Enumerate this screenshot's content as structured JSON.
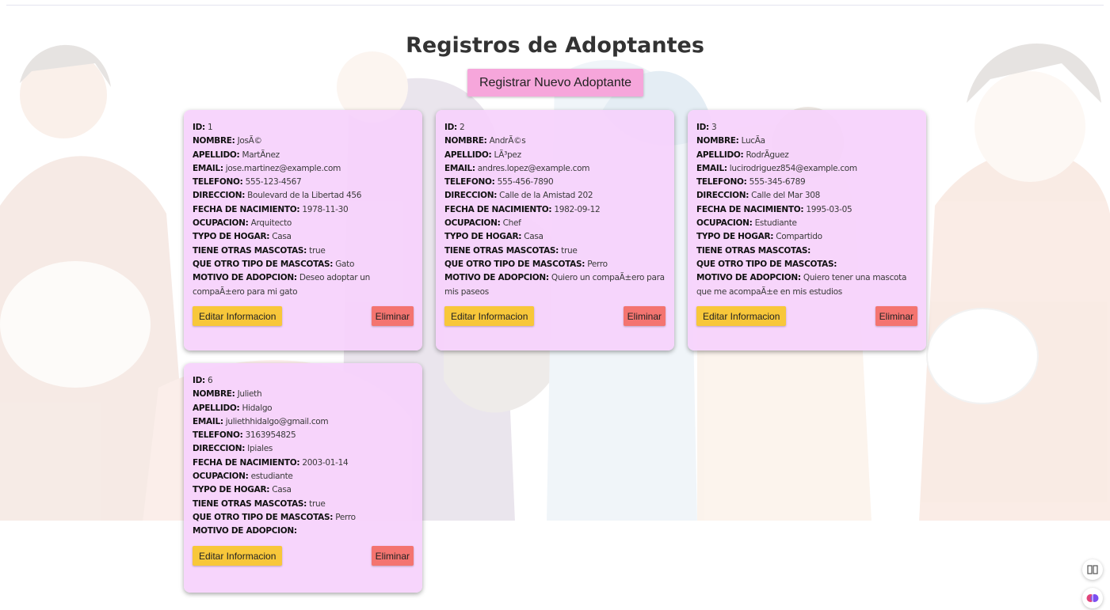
{
  "page": {
    "title": "Registros de Adoptantes",
    "register_button": "Registrar Nuevo Adoptante"
  },
  "labels": {
    "id": "ID:",
    "nombre": "NOMBRE:",
    "apellido": "APELLIDO:",
    "email": "EMAIL:",
    "telefono": "TELEFONO:",
    "direccion": "DIRECCION:",
    "fecha": "FECHA DE NACIMIENTO:",
    "ocupacion": "OCUPACION:",
    "hogar": "TYPO DE HOGAR:",
    "otras": "TIENE OTRAS MASCOTAS:",
    "tipo": "QUE OTRO TIPO DE MASCOTAS:",
    "motivo": "MOTIVO DE ADOPCION:"
  },
  "buttons": {
    "edit": "Editar Informacion",
    "delete": "Eliminar"
  },
  "cards": [
    {
      "id": "1",
      "nombre": "JosÃ©",
      "apellido": "MartÃnez",
      "email": "jose.martinez@example.com",
      "telefono": "555-123-4567",
      "direccion": "Boulevard de la Libertad 456",
      "fecha": "1978-11-30",
      "ocupacion": "Arquitecto",
      "hogar": "Casa",
      "otras": "true",
      "tipo": "Gato",
      "motivo": "Deseo adoptar un compaÃ±ero para mi gato"
    },
    {
      "id": "2",
      "nombre": "AndrÃ©s",
      "apellido": "LÃ³pez",
      "email": "andres.lopez@example.com",
      "telefono": "555-456-7890",
      "direccion": "Calle de la Amistad 202",
      "fecha": "1982-09-12",
      "ocupacion": "Chef",
      "hogar": "Casa",
      "otras": "true",
      "tipo": "Perro",
      "motivo": "Quiero un compaÃ±ero para mis paseos"
    },
    {
      "id": "3",
      "nombre": "LucÃa",
      "apellido": "RodrÃguez",
      "email": "lucirodriguez854@example.com",
      "telefono": "555-345-6789",
      "direccion": "Calle del Mar 308",
      "fecha": "1995-03-05",
      "ocupacion": "Estudiante",
      "hogar": "Compartido",
      "otras": "",
      "tipo": "",
      "motivo": "Quiero tener una mascota que me acompaÃ±e en mis estudios"
    },
    {
      "id": "6",
      "nombre": "Julieth",
      "apellido": "Hidalgo",
      "email": "juliethhidalgo@gmail.com",
      "telefono": "3163954825",
      "direccion": "Ipiales",
      "fecha": "2003-01-14",
      "ocupacion": "estudiante",
      "hogar": "Casa",
      "otras": "true",
      "tipo": "Perro",
      "motivo": ""
    }
  ],
  "icons": {
    "reader": "book-reader-icon",
    "assistant": "brain-icon"
  },
  "colors": {
    "card_bg": "#f6d2fc",
    "register_button": "#f6a6db",
    "edit_button": "#f8c73a",
    "delete_button": "#f47470"
  }
}
